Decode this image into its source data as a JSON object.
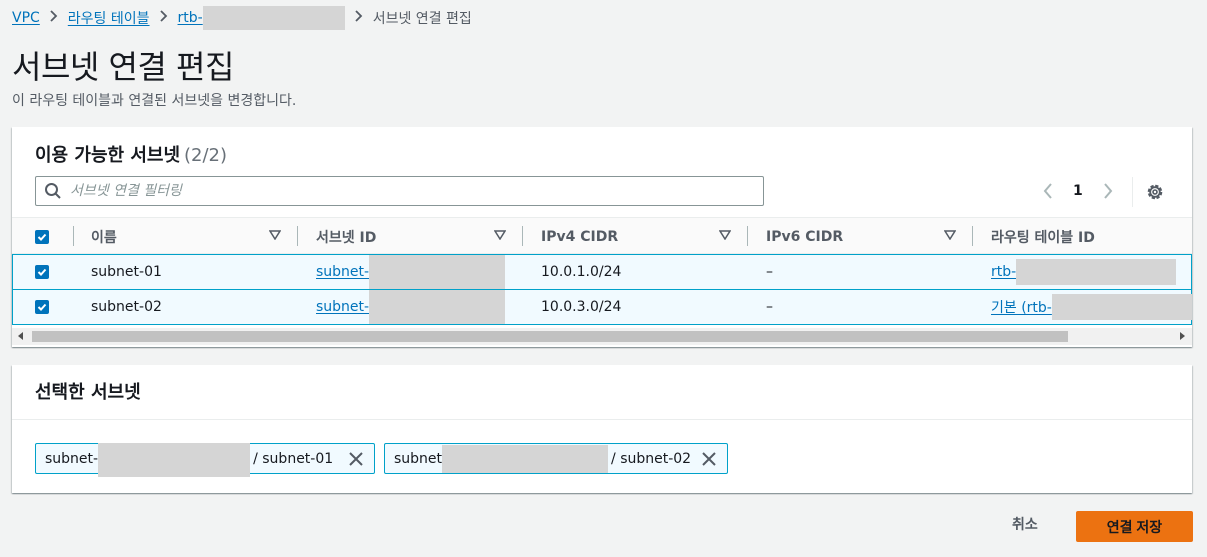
{
  "breadcrumb": {
    "items": [
      "VPC",
      "라우팅 테이블",
      "rtb-"
    ],
    "current": "서브넷 연결 편집"
  },
  "page": {
    "title": "서브넷 연결 편집",
    "description": "이 라우팅 테이블과 연결된 서브넷을 변경합니다."
  },
  "available": {
    "title": "이용 가능한 서브넷",
    "count": "(2/2)",
    "filter_placeholder": "서브넷 연결 필터링",
    "page_number": "1",
    "columns": [
      "이름",
      "서브넷 ID",
      "IPv4 CIDR",
      "IPv6 CIDR",
      "라우팅 테이블 ID"
    ],
    "rows": [
      {
        "name": "subnet-01",
        "subnet_id": "subnet-",
        "ipv4": "10.0.1.0/24",
        "ipv6": "–",
        "route_table": "rtb-"
      },
      {
        "name": "subnet-02",
        "subnet_id": "subnet-",
        "ipv4": "10.0.3.0/24",
        "ipv6": "–",
        "route_table": "기본 (rtb-"
      }
    ]
  },
  "selected": {
    "title": "선택한 서브넷",
    "tokens": [
      {
        "prefix": "subnet-",
        "suffix": "/ subnet-01"
      },
      {
        "prefix": "subnet",
        "suffix": "/ subnet-02"
      }
    ]
  },
  "footer": {
    "cancel_label": "취소",
    "save_label": "연결 저장"
  },
  "colors": {
    "link": "#0073bb",
    "primary_button": "#ec7211",
    "selected_row_bg": "#f1faff",
    "selected_row_border": "#00a1c9"
  }
}
